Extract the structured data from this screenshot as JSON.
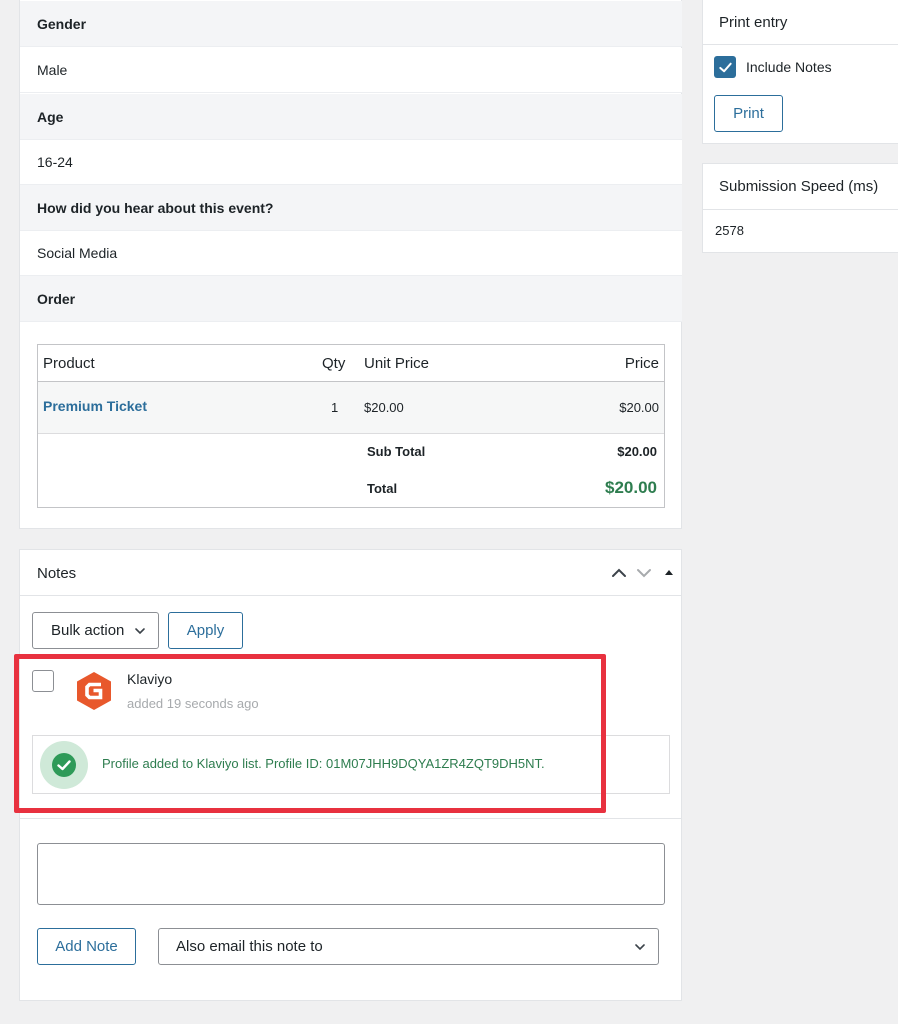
{
  "entry": {
    "fields": [
      {
        "label": "Gender",
        "value": "Male"
      },
      {
        "label": "Age",
        "value": "16-24"
      },
      {
        "label": "How did you hear about this event?",
        "value": "Social Media"
      },
      {
        "label": "Order",
        "value": ""
      }
    ],
    "order": {
      "headers": {
        "product": "Product",
        "qty": "Qty",
        "unit_price": "Unit Price",
        "price": "Price"
      },
      "items": [
        {
          "product": "Premium Ticket",
          "qty": "1",
          "unit_price": "$20.00",
          "price": "$20.00"
        }
      ],
      "subtotal_label": "Sub Total",
      "subtotal_value": "$20.00",
      "total_label": "Total",
      "total_value": "$20.00"
    }
  },
  "print_entry": {
    "title": "Print entry",
    "include_notes_label": "Include Notes",
    "include_notes_checked": true,
    "print_button": "Print"
  },
  "submission_speed": {
    "title": "Submission Speed (ms)",
    "value": "2578"
  },
  "notes": {
    "title": "Notes",
    "bulk_action": "Bulk action",
    "apply_button": "Apply",
    "note": {
      "author": "Klaviyo",
      "time": "added 19 seconds ago",
      "message": "Profile added to Klaviyo list. Profile ID: 01M07JHH9DQYA1ZR4ZQT9DH5NT."
    },
    "add_note_button": "Add Note",
    "email_select": "Also email this note to"
  },
  "colors": {
    "accent": "#2c6e9b",
    "success": "#2e8b57",
    "highlight": "#e8313f",
    "logo": "#e8582c"
  }
}
